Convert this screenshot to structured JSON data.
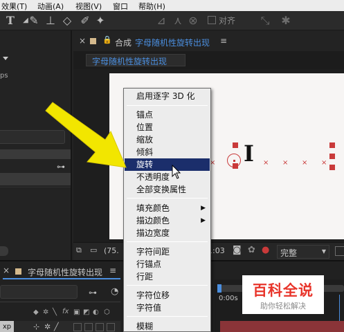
{
  "menubar": {
    "items": [
      "效果(T)",
      "动画(A)",
      "视图(V)",
      "窗口",
      "帮助(H)"
    ],
    "snap_label": "对齐"
  },
  "left_panel": {
    "truncated_text": "ps"
  },
  "composition": {
    "panel_title_prefix": "合成",
    "panel_title": "字母随机性旋转出现",
    "breadcrumb": "字母随机性旋转出现",
    "letter": "I",
    "zoom_text": "(75.",
    "timecode_fragment": "1:03",
    "quality": "完整"
  },
  "timeline": {
    "tab_title": "字母随机性旋转出现",
    "time_marker": "0:00s",
    "layer_label": "xp"
  },
  "context_menu": {
    "header": "启用逐字 3D 化",
    "transform_items": [
      "锚点",
      "位置",
      "缩放",
      "倾斜",
      "旋转",
      "不透明度",
      "全部变换属性"
    ],
    "highlighted": "旋转",
    "fill_items": [
      "填充颜色",
      "描边颜色",
      "描边宽度"
    ],
    "char_items": [
      "字符间距",
      "行锚点",
      "行距"
    ],
    "offset_items": [
      "字符位移",
      "字符值"
    ],
    "blur_items": [
      "模糊"
    ]
  },
  "watermark": {
    "title": "百科全说",
    "subtitle": "助你轻松解决"
  },
  "colors": {
    "menu_highlight": "#1b2e6b",
    "accent_blue": "#4b8fe0",
    "arrow_yellow": "#f2e600",
    "canvas": "#f7f5f4",
    "watermark_red": "#e8342a",
    "selection_red": "#c93a3a",
    "timeline_bar": "#8a3438"
  }
}
